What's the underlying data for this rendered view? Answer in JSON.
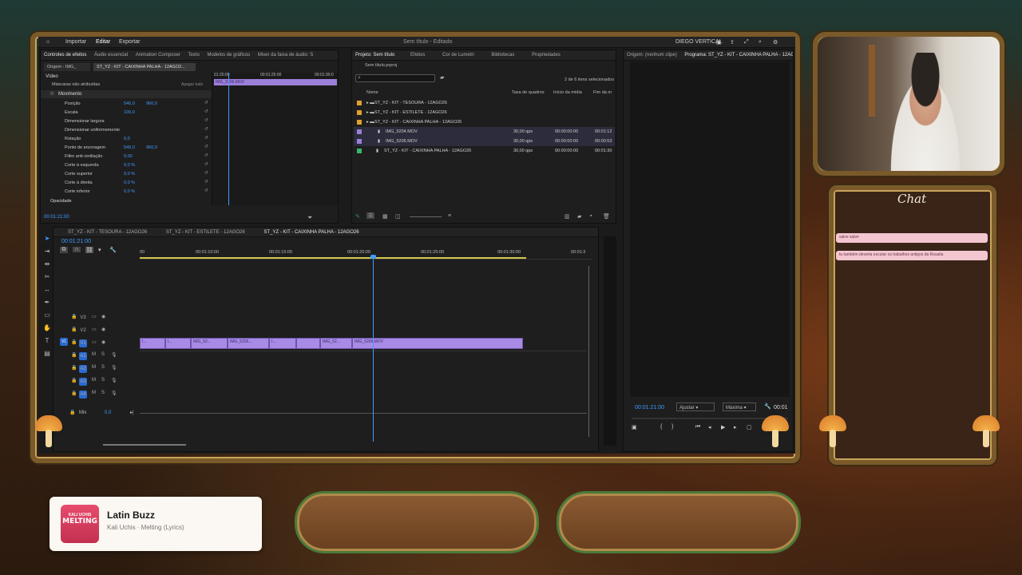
{
  "app": {
    "menu_left": [
      "Importar",
      "Editar",
      "Exportar"
    ],
    "title": "Sem título - Editado",
    "workspace": "DIEGO VERTICAL"
  },
  "effects_panel": {
    "tabs": [
      "Controles de efeitos",
      "Áudio essencial",
      "Animation Composer",
      "Texto",
      "Modelos de gráficos",
      "Mixer da faixa de áudio: S"
    ],
    "source": "Origem - IMG_",
    "clip": "ST_YZ - KIT - CAIXINHA PALHA - 12AGO2...",
    "section": "Vídeo",
    "unassigned": "Máscaras não atribuídas",
    "reset_all": "Apagar tudo",
    "motion": "Movimento",
    "rows": [
      {
        "label": "Posição",
        "v1": "540,0",
        "v2": "960,0"
      },
      {
        "label": "Escala",
        "v1": "100,0",
        "v2": ""
      },
      {
        "label": "Dimensionar largura",
        "v1": "",
        "v2": ""
      },
      {
        "label": "Dimensionar uniformemente",
        "v1": "",
        "v2": ""
      },
      {
        "label": "Rotação",
        "v1": "0,0",
        "v2": ""
      },
      {
        "label": "Ponto de ancoragem",
        "v1": "540,0",
        "v2": "960,0"
      },
      {
        "label": "Filtro anti-cintilação",
        "v1": "0,00",
        "v2": ""
      },
      {
        "label": "Corte à esquerda",
        "v1": "0,0 %",
        "v2": ""
      },
      {
        "label": "Corte superior",
        "v1": "0,0 %",
        "v2": ""
      },
      {
        "label": "Corte à direita",
        "v1": "0,0 %",
        "v2": ""
      },
      {
        "label": "Corte inferior",
        "v1": "0,0 %",
        "v2": ""
      }
    ],
    "opacity": "Opacidade",
    "timecode": "00:01:21:00",
    "mini_ruler": [
      "01:20:00",
      "00:01:25:00",
      "00:01:30:0"
    ],
    "mini_clip": "IMG_5206.MOV"
  },
  "project_panel": {
    "tabs": [
      "Projeto: Sem título",
      "Efeitos",
      "Cor de Lumetri",
      "Bibliotecas",
      "Propriedades"
    ],
    "file": "Sem título.prproj",
    "selection": "2 de 6 itens selecionados",
    "columns": [
      "Nome",
      "Taxa de quadros",
      "Início da mídia",
      "Fim da m"
    ],
    "items": [
      {
        "name": "ST_YZ - KIT - TESOURA - 12AGO26",
        "fps": "",
        "start": "",
        "end": ""
      },
      {
        "name": "ST_YZ - KIT - ESTILETE - 12AGO26",
        "fps": "",
        "start": "",
        "end": ""
      },
      {
        "name": "ST_YZ - KIT - CAIXINHA PALHA - 12AGO26",
        "fps": "",
        "start": "",
        "end": ""
      },
      {
        "name": "IMG_5204.MOV",
        "fps": "30,00 qps",
        "start": "00:00:00:00",
        "end": "00:01:12"
      },
      {
        "name": "IMG_5206.MOV",
        "fps": "30,00 qps",
        "start": "00:00:00:00",
        "end": "00:00:53"
      },
      {
        "name": "ST_YZ - KIT - CAIXINHA PALHA - 12AGO26",
        "fps": "30,00 qps",
        "start": "00:00:00:00",
        "end": "00:01:30"
      }
    ]
  },
  "program_panel": {
    "source": "Origem: (nenhum clipe)",
    "program": "Programa: ST_YZ - KIT - CAIXINHA PALHA - 12AGO26",
    "timecode": "00:01:21:00",
    "fit": "Ajustar",
    "quality": "Máxima",
    "tc_right": "00:01"
  },
  "timeline": {
    "tabs": [
      "ST_YZ - KIT - TESOURA - 12AGO26",
      "ST_YZ - KIT - ESTILETE - 12AGO26",
      "ST_YZ - KIT - CAIXINHA PALHA - 12AGO26"
    ],
    "timecode": "00:01:21:00",
    "ruler": [
      "00",
      "00:01:10:00",
      "00:01:15:00",
      "00:01:20:00",
      "00:01:25:00",
      "00:01:30:00",
      "00:01:3"
    ],
    "video_tracks": [
      "V3",
      "V2",
      "V1"
    ],
    "audio_tracks": [
      "A1",
      "A2",
      "A3",
      "A4"
    ],
    "mix": "Mix",
    "mix_value": "0,0",
    "clips": [
      "I...",
      "I...",
      "IMG_52...",
      "IMG_5206...",
      "I...",
      "",
      "IMG_52...",
      "IMG_5206.MOV"
    ]
  },
  "chat": {
    "title": "Chat",
    "messages": [
      "salve salve",
      "tu também deveria escutar os trabalhos antigos da Rosalia"
    ]
  },
  "music": {
    "title": "Latin Buzz",
    "subtitle": "Kali Uchis · Melting (Lyrics)",
    "art_top": "KALI UCHIS",
    "art": "MELTING"
  }
}
